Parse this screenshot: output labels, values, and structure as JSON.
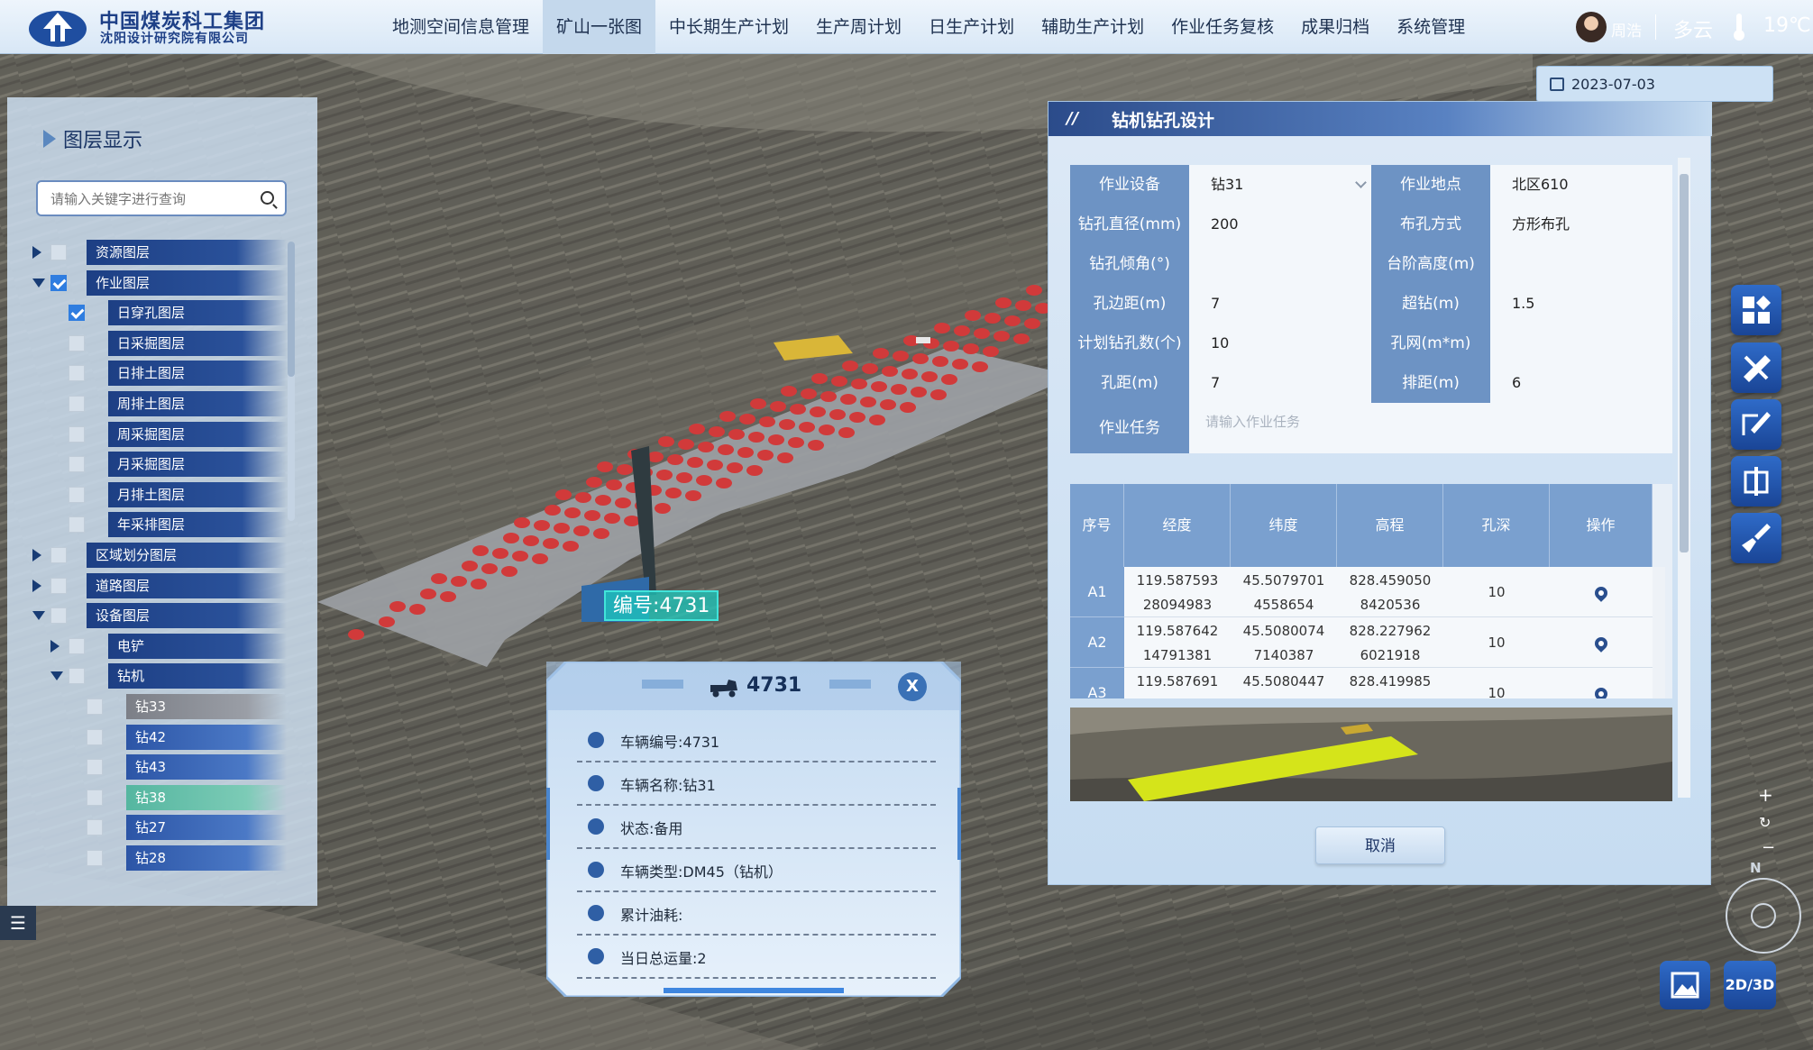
{
  "header": {
    "brand_line1": "中国煤炭科工集团",
    "brand_line2": "沈阳设计研究院有限公司",
    "nav": [
      "地测空间信息管理",
      "矿山一张图",
      "中长期生产计划",
      "生产周计划",
      "日生产计划",
      "辅助生产计划",
      "作业任务复核",
      "成果归档",
      "系统管理"
    ],
    "active_nav": 1,
    "user": "周浩",
    "weather": "多云",
    "temperature": "19℃"
  },
  "date": "2023-07-03",
  "layer_panel": {
    "title": "图层显示",
    "search_placeholder": "请输入关键字进行查询",
    "items": [
      {
        "label": "资源图层",
        "indent": 0,
        "toggle": "right",
        "checked": false,
        "style": ""
      },
      {
        "label": "作业图层",
        "indent": 0,
        "toggle": "down",
        "checked": true,
        "style": ""
      },
      {
        "label": "日穿孔图层",
        "indent": 1,
        "toggle": "",
        "checked": true,
        "style": ""
      },
      {
        "label": "日采掘图层",
        "indent": 1,
        "toggle": "",
        "checked": false,
        "style": ""
      },
      {
        "label": "日排土图层",
        "indent": 1,
        "toggle": "",
        "checked": false,
        "style": ""
      },
      {
        "label": "周排土图层",
        "indent": 1,
        "toggle": "",
        "checked": false,
        "style": ""
      },
      {
        "label": "周采掘图层",
        "indent": 1,
        "toggle": "",
        "checked": false,
        "style": ""
      },
      {
        "label": "月采掘图层",
        "indent": 1,
        "toggle": "",
        "checked": false,
        "style": ""
      },
      {
        "label": "月排土图层",
        "indent": 1,
        "toggle": "",
        "checked": false,
        "style": ""
      },
      {
        "label": "年采排图层",
        "indent": 1,
        "toggle": "",
        "checked": false,
        "style": ""
      },
      {
        "label": "区域划分图层",
        "indent": 0,
        "toggle": "right",
        "checked": false,
        "style": ""
      },
      {
        "label": "道路图层",
        "indent": 0,
        "toggle": "right",
        "checked": false,
        "style": ""
      },
      {
        "label": "设备图层",
        "indent": 0,
        "toggle": "down",
        "checked": false,
        "style": ""
      },
      {
        "label": "电铲",
        "indent": 1,
        "toggle": "right",
        "checked": false,
        "style": ""
      },
      {
        "label": "钻机",
        "indent": 1,
        "toggle": "down",
        "checked": false,
        "style": ""
      },
      {
        "label": "钻33",
        "indent": 2,
        "toggle": "",
        "checked": false,
        "style": "g1"
      },
      {
        "label": "钻42",
        "indent": 2,
        "toggle": "",
        "checked": false,
        "style": "g2"
      },
      {
        "label": "钻43",
        "indent": 2,
        "toggle": "",
        "checked": false,
        "style": "g2"
      },
      {
        "label": "钻38",
        "indent": 2,
        "toggle": "",
        "checked": false,
        "style": "g3"
      },
      {
        "label": "钻27",
        "indent": 2,
        "toggle": "",
        "checked": false,
        "style": "g2"
      },
      {
        "label": "钻28",
        "indent": 2,
        "toggle": "",
        "checked": false,
        "style": "g2"
      }
    ]
  },
  "design_panel": {
    "mark": "//",
    "title": "钻机钻孔设计",
    "fields": [
      {
        "label": "作业设备",
        "value": "钻31",
        "label2": "作业地点",
        "value2": "北区610"
      },
      {
        "label": "钻孔直径(mm)",
        "value": "200",
        "label2": "布孔方式",
        "value2": "方形布孔"
      },
      {
        "label": "钻孔倾角(°)",
        "value": "",
        "label2": "台阶高度(m)",
        "value2": ""
      },
      {
        "label": "孔边距(m)",
        "value": "7",
        "label2": "超钻(m)",
        "value2": "1.5"
      },
      {
        "label": "计划钻孔数(个)",
        "value": "10",
        "label2": "孔网(m*m)",
        "value2": ""
      },
      {
        "label": "孔距(m)",
        "value": "7",
        "label2": "排距(m)",
        "value2": "6"
      }
    ],
    "task_label": "作业任务",
    "task_placeholder": "请输入作业任务",
    "table": {
      "headers": [
        "序号",
        "经度",
        "纬度",
        "高程",
        "孔深",
        "操作"
      ],
      "rows": [
        {
          "id": "A1",
          "lng": "119.587593\n28094983",
          "lat": "45.5079701\n4558654",
          "elev": "828.459050\n8420536",
          "depth": "10"
        },
        {
          "id": "A2",
          "lng": "119.587642\n14791381",
          "lat": "45.5080074\n7140387",
          "elev": "828.227962\n6021918",
          "depth": "10"
        },
        {
          "id": "A3",
          "lng": "119.587691",
          "lat": "45.5080447",
          "elev": "828.419985",
          "depth": "10"
        }
      ]
    },
    "cancel_label": "取消"
  },
  "vehicle_popup": {
    "title": "4731",
    "close_label": "X",
    "lines": [
      "车辆编号:4731",
      "车辆名称:钻31",
      "状态:备用",
      "车辆类型:DM45（钻机）",
      "累计油耗:",
      "当日总运量:2"
    ]
  },
  "map": {
    "drill_label": "编号:4731",
    "compass_north": "N",
    "mode_label": "2D/3D",
    "zoom_plus": "+",
    "zoom_reset": "↻",
    "zoom_minus": "−"
  }
}
